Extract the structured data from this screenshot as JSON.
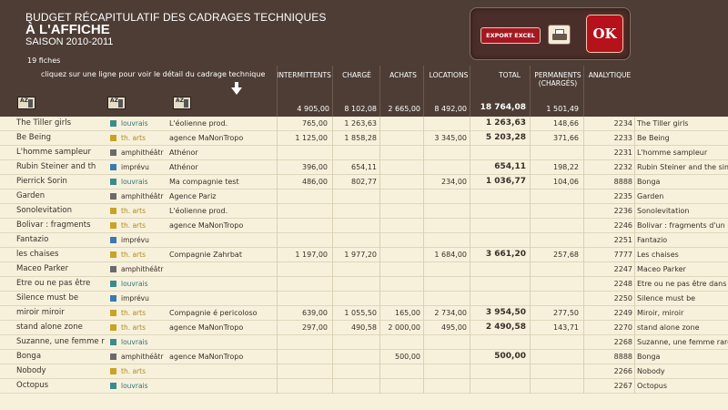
{
  "header": {
    "title1": "BUDGET RÉCAPITULATIF DES CADRAGES TECHNIQUES",
    "title2": "À L'AFFICHE",
    "title3": "SAISON 2010-2011",
    "count": "19 fiches",
    "hint": "cliquez sur une ligne pour voir le détail du cadrage technique",
    "sort_label": "AZ"
  },
  "buttons": {
    "export": "EXPORT EXCEL",
    "ok": "OK"
  },
  "columns": {
    "intermittents": "INTERMITTENTS",
    "charge": "CHARGÉ",
    "achats": "ACHATS",
    "locations": "LOCATIONS",
    "total": "TOTAL",
    "permanents_l1": "PERMANENTS",
    "permanents_l2": "(CHARGÉS)",
    "analytique": "ANALYTIQUE"
  },
  "totals": {
    "intermittents": "4 905,00",
    "charge": "8 102,08",
    "achats": "2 665,00",
    "locations": "8 492,00",
    "total": "18 764,08",
    "permanents": "1 501,49"
  },
  "colors": {
    "header_bg": "#4d3d35",
    "row_bg": "#f7f1dc",
    "louvrais": "#3a8c8c",
    "th_arts": "#c9a227",
    "amphitheatre": "#6a6a6a",
    "imprevu": "#3a7ab0",
    "ok_red": "#b5121b"
  },
  "rows": [
    {
      "titre": "The Tiller girls",
      "lieu": "louvrais",
      "lieu_color": "#3a8c8c",
      "lieu_text_color": "#2f7575",
      "prod": "L'éolienne prod.",
      "int": "765,00",
      "chg": "1 263,63",
      "ach": "",
      "loc": "",
      "tot": "1 263,63",
      "perm": "148,66",
      "ana": "2234",
      "lib": "The Tiller girls"
    },
    {
      "titre": "Be Being",
      "lieu": "th. arts",
      "lieu_color": "#c9a227",
      "lieu_text_color": "#b08a1c",
      "prod": "agence MaNonTropo",
      "int": "1 125,00",
      "chg": "1 858,28",
      "ach": "",
      "loc": "3 345,00",
      "tot": "5 203,28",
      "perm": "371,66",
      "ana": "2233",
      "lib": "Be Being"
    },
    {
      "titre": "L'homme sampleur",
      "lieu": "amphithéâtr",
      "lieu_color": "#6a6a6a",
      "lieu_text_color": "#3a2e28",
      "prod": "Athénor",
      "int": "",
      "chg": "",
      "ach": "",
      "loc": "",
      "tot": "",
      "perm": "",
      "ana": "2231",
      "lib": "L'homme sampleur"
    },
    {
      "titre": "Rubin Steiner and th",
      "lieu": "imprévu",
      "lieu_color": "#3a7ab0",
      "lieu_text_color": "#3a2e28",
      "prod": "Athénor",
      "int": "396,00",
      "chg": "654,11",
      "ach": "",
      "loc": "",
      "tot": "654,11",
      "perm": "198,22",
      "ana": "2232",
      "lib": "Rubin Steiner and the simp"
    },
    {
      "titre": "Pierrick Sorin",
      "lieu": "louvrais",
      "lieu_color": "#3a8c8c",
      "lieu_text_color": "#2f7575",
      "prod": "Ma compagnie test",
      "int": "486,00",
      "chg": "802,77",
      "ach": "",
      "loc": "234,00",
      "tot": "1 036,77",
      "perm": "104,06",
      "ana": "8888",
      "lib": "Bonga"
    },
    {
      "titre": "Garden",
      "lieu": "amphithéâtr",
      "lieu_color": "#6a6a6a",
      "lieu_text_color": "#3a2e28",
      "prod": "Agence Pariz",
      "int": "",
      "chg": "",
      "ach": "",
      "loc": "",
      "tot": "",
      "perm": "",
      "ana": "2235",
      "lib": "Garden"
    },
    {
      "titre": "Sonolevitation",
      "lieu": "th. arts",
      "lieu_color": "#c9a227",
      "lieu_text_color": "#b08a1c",
      "prod": "L'éolienne prod.",
      "int": "",
      "chg": "",
      "ach": "",
      "loc": "",
      "tot": "",
      "perm": "",
      "ana": "2236",
      "lib": "Sonolevitation"
    },
    {
      "titre": "Bolivar : fragments",
      "lieu": "th. arts",
      "lieu_color": "#c9a227",
      "lieu_text_color": "#b08a1c",
      "prod": "agence MaNonTropo",
      "int": "",
      "chg": "",
      "ach": "",
      "loc": "",
      "tot": "",
      "perm": "",
      "ana": "2246",
      "lib": "Bolivar : fragments d'un ré"
    },
    {
      "titre": "Fantazio",
      "lieu": "imprévu",
      "lieu_color": "#3a7ab0",
      "lieu_text_color": "#3a2e28",
      "prod": "",
      "int": "",
      "chg": "",
      "ach": "",
      "loc": "",
      "tot": "",
      "perm": "",
      "ana": "2251",
      "lib": "Fantazio"
    },
    {
      "titre": "les chaises",
      "lieu": "th. arts",
      "lieu_color": "#c9a227",
      "lieu_text_color": "#b08a1c",
      "prod": "Compagnie Zahrbat",
      "int": "1 197,00",
      "chg": "1 977,20",
      "ach": "",
      "loc": "1 684,00",
      "tot": "3 661,20",
      "perm": "257,68",
      "ana": "7777",
      "lib": "Les chaises"
    },
    {
      "titre": "Maceo Parker",
      "lieu": "amphithéâtr",
      "lieu_color": "#6a6a6a",
      "lieu_text_color": "#3a2e28",
      "prod": "",
      "int": "",
      "chg": "",
      "ach": "",
      "loc": "",
      "tot": "",
      "perm": "",
      "ana": "2247",
      "lib": "Maceo Parker"
    },
    {
      "titre": "Etre ou ne pas être",
      "lieu": "louvrais",
      "lieu_color": "#3a8c8c",
      "lieu_text_color": "#2f7575",
      "prod": "",
      "int": "",
      "chg": "",
      "ach": "",
      "loc": "",
      "tot": "",
      "perm": "",
      "ana": "2248",
      "lib": "Etre ou ne pas être dans les"
    },
    {
      "titre": "Silence must be",
      "lieu": "imprévu",
      "lieu_color": "#3a7ab0",
      "lieu_text_color": "#3a2e28",
      "prod": "",
      "int": "",
      "chg": "",
      "ach": "",
      "loc": "",
      "tot": "",
      "perm": "",
      "ana": "2250",
      "lib": "Silence must be"
    },
    {
      "titre": "miroir miroir",
      "lieu": "th. arts",
      "lieu_color": "#c9a227",
      "lieu_text_color": "#b08a1c",
      "prod": "Compagnie é pericoloso",
      "int": "639,00",
      "chg": "1 055,50",
      "ach": "165,00",
      "loc": "2 734,00",
      "tot": "3 954,50",
      "perm": "277,50",
      "ana": "2249",
      "lib": "Miroir, miroir"
    },
    {
      "titre": "stand alone zone",
      "lieu": "th. arts",
      "lieu_color": "#c9a227",
      "lieu_text_color": "#b08a1c",
      "prod": "agence MaNonTropo",
      "int": "297,00",
      "chg": "490,58",
      "ach": "2 000,00",
      "loc": "495,00",
      "tot": "2 490,58",
      "perm": "143,71",
      "ana": "2270",
      "lib": "stand alone zone"
    },
    {
      "titre": "Suzanne, une femme r",
      "lieu": "louvrais",
      "lieu_color": "#3a8c8c",
      "lieu_text_color": "#2f7575",
      "prod": "",
      "int": "",
      "chg": "",
      "ach": "",
      "loc": "",
      "tot": "",
      "perm": "",
      "ana": "2268",
      "lib": "Suzanne, une femme rare"
    },
    {
      "titre": "Bonga",
      "lieu": "amphithéâtr",
      "lieu_color": "#6a6a6a",
      "lieu_text_color": "#3a2e28",
      "prod": "agence MaNonTropo",
      "int": "",
      "chg": "",
      "ach": "500,00",
      "loc": "",
      "tot": "500,00",
      "perm": "",
      "ana": "8888",
      "lib": "Bonga"
    },
    {
      "titre": "Nobody",
      "lieu": "th. arts",
      "lieu_color": "#c9a227",
      "lieu_text_color": "#b08a1c",
      "prod": "",
      "int": "",
      "chg": "",
      "ach": "",
      "loc": "",
      "tot": "",
      "perm": "",
      "ana": "2266",
      "lib": "Nobody"
    },
    {
      "titre": "Octopus",
      "lieu": "louvrais",
      "lieu_color": "#3a8c8c",
      "lieu_text_color": "#2f7575",
      "prod": "",
      "int": "",
      "chg": "",
      "ach": "",
      "loc": "",
      "tot": "",
      "perm": "",
      "ana": "2267",
      "lib": "Octopus"
    }
  ]
}
